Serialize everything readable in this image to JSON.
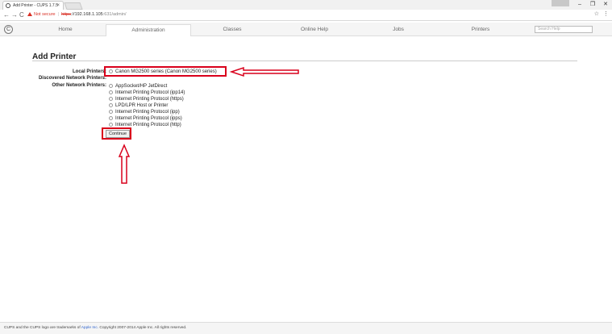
{
  "browser": {
    "tab_title": "Add Printer - CUPS 1.7.5",
    "tab_close": "×",
    "back": "←",
    "forward": "→",
    "reload": "C",
    "not_secure": "Not secure",
    "url_scheme": "https",
    "url_host": "://192.168.1.105",
    "url_rest": ":631/admin/",
    "star": "☆",
    "menu": "⋮",
    "minimize": "–",
    "maximize": "❐",
    "close": "✕"
  },
  "cups_nav": {
    "tabs": [
      {
        "label": "Home"
      },
      {
        "label": "Administration"
      },
      {
        "label": "Classes"
      },
      {
        "label": "Online Help"
      },
      {
        "label": "Jobs"
      },
      {
        "label": "Printers"
      }
    ],
    "active_tab": "Administration",
    "search_placeholder": "Search Help"
  },
  "page": {
    "title": "Add Printer",
    "local_printers_label": "Local Printers:",
    "discovered_label": "Discovered Network Printers:",
    "other_label": "Other Network Printers:",
    "local_printers": [
      "Canon MG2500 series (Canon MG2500 series)"
    ],
    "other_printers": [
      "AppSocket/HP JetDirect",
      "Internet Printing Protocol (ipp14)",
      "Internet Printing Protocol (https)",
      "LPD/LPR Host or Printer",
      "Internet Printing Protocol (ipp)",
      "Internet Printing Protocol (ipps)",
      "Internet Printing Protocol (http)"
    ],
    "continue_label": "Continue"
  },
  "footer": {
    "text_before": "CUPS and the CUPS logo are trademarks of ",
    "link": "Apple Inc.",
    "text_after": " Copyright 2007-2014 Apple Inc. All rights reserved."
  },
  "colors": {
    "annotation_red": "#d9001b",
    "warning_red": "#d93025",
    "link_blue": "#3366cc"
  }
}
